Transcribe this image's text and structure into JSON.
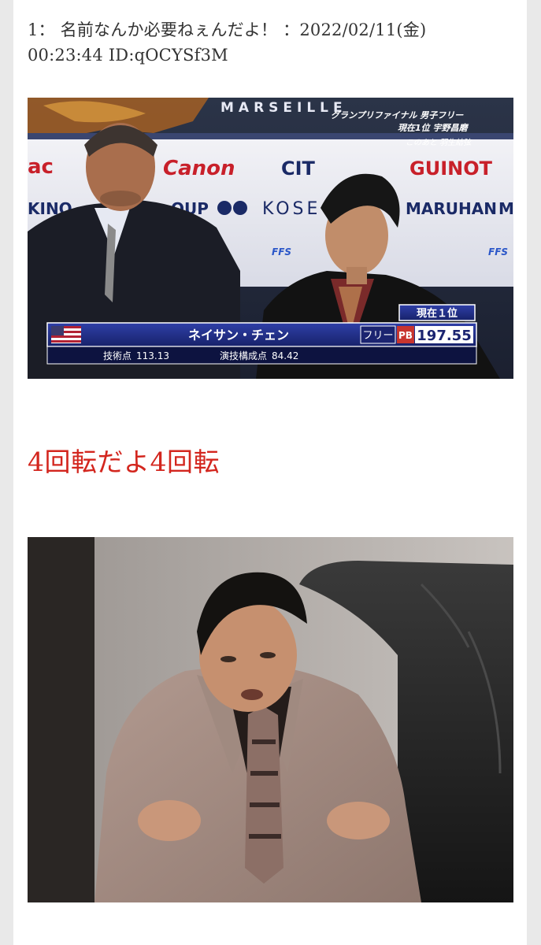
{
  "post": {
    "number": "1：",
    "name": "名前なんか必要ねぇんだよ！",
    "date": "：2022/02/11(金)",
    "time": "00:23:44",
    "id": "ID:qOCYSf3M"
  },
  "reply_text": "4回転だよ4回転",
  "image1": {
    "banner": "MARSEILLE",
    "caption_line1": "グランプリファイナル 男子フリー",
    "caption_line2": "現在1位 宇野昌磨",
    "caption_line3": "このあと 羽生結弦",
    "sponsors": [
      "ac",
      "Canon",
      "CIT",
      "GUINOT",
      "KINO",
      "OUP",
      "KOSE",
      "MARUHAN",
      "M",
      "FFS",
      "FFS"
    ],
    "rank_label": "現在１位",
    "skater_name": "ネイサン・チェン",
    "segment": "フリー",
    "pb_badge": "PB",
    "total_score": "197.55",
    "tech_label": "技術点",
    "tech_score": "113.13",
    "comp_label": "演技構成点",
    "comp_score": "84.42"
  },
  "colors": {
    "reply_text": "#d3261e",
    "score_bar": "#1f2d8a",
    "pb_badge": "#c8352f"
  }
}
